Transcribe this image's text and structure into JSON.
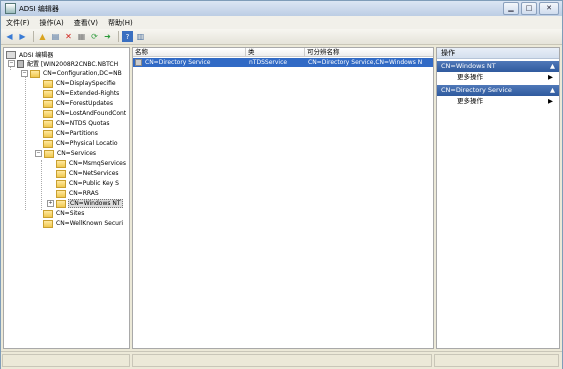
{
  "window": {
    "title": "ADSI 编辑器",
    "min": "▁",
    "max": "□",
    "close": "✕"
  },
  "menu": [
    "文件(F)",
    "操作(A)",
    "查看(V)",
    "帮助(H)"
  ],
  "tree": {
    "root": "ADSI 编辑器",
    "config": "配置 [WIN2008R2CNBC.NBTCH",
    "configdn": "CN=Configuration,DC=NB",
    "items": [
      "CN=DisplaySpecifie",
      "CN=Extended-Rights",
      "CN=ForestUpdates",
      "CN=LostAndFoundCont",
      "CN=NTDS Quotas",
      "CN=Partitions",
      "CN=Physical Locatio"
    ],
    "services": "CN=Services",
    "services_children": [
      "CN=MsmqServices",
      "CN=NetServices",
      "CN=Public Key S",
      "CN=RRAS"
    ],
    "windows_nt": "CN=Windows NT",
    "after": [
      "CN=Sites",
      "CN=WellKnown Securi"
    ]
  },
  "list": {
    "headers": [
      "名称",
      "类",
      "可分辨名称"
    ],
    "row": {
      "name": "CN=Directory Service",
      "class": "nTDSService",
      "dn": "CN=Directory Service,CN=Windows N"
    }
  },
  "actions": {
    "header": "操作",
    "sections": [
      {
        "title": "CN=Windows NT",
        "item": "更多操作"
      },
      {
        "title": "CN=Directory Service",
        "item": "更多操作"
      }
    ]
  }
}
